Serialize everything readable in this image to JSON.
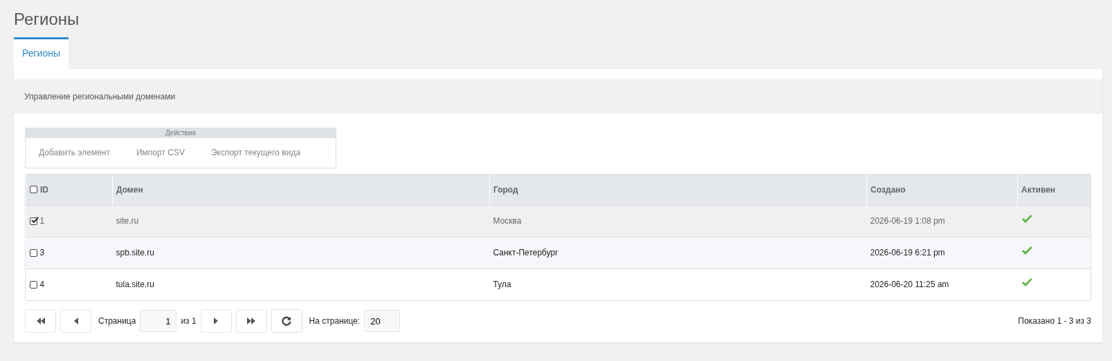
{
  "page_title": "Регионы",
  "tabs": [
    {
      "label": "Регионы",
      "selected": true
    }
  ],
  "panel": {
    "heading": "Управление региональными доменами",
    "actions": {
      "title": "Действия",
      "buttons": [
        "Добавить элемент",
        "Импорт CSV",
        "Экспорт текущего вида"
      ]
    },
    "table": {
      "all_checked": false,
      "columns": [
        "ID",
        "Домен",
        "Город",
        "Создано",
        "Активен"
      ],
      "rows": [
        {
          "checked": true,
          "selected": true,
          "id": "1",
          "domain": "site.ru",
          "city": "Москва",
          "created": "2026-06-19 1:08 pm",
          "active": true
        },
        {
          "checked": false,
          "selected": false,
          "id": "3",
          "domain": "spb.site.ru",
          "city": "Санкт-Петербург",
          "created": "2026-06-19 6:21 pm",
          "active": true
        },
        {
          "checked": false,
          "selected": false,
          "id": "4",
          "domain": "tula.site.ru",
          "city": "Тула",
          "created": "2026-06-20 11:25 am",
          "active": true
        }
      ]
    },
    "pager": {
      "page_label": "Страница",
      "page": "1",
      "of_label": "из 1",
      "per_page_label": "На странице:",
      "per_page": "20",
      "summary": "Показано 1 - 3 из 3"
    }
  }
}
